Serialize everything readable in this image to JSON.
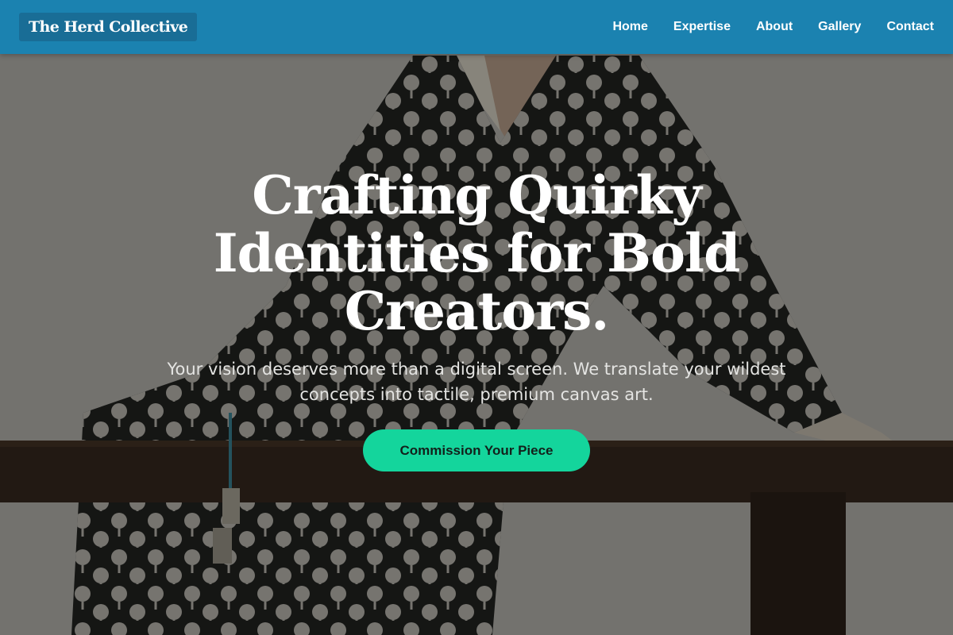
{
  "header": {
    "logo_text": "The Herd Collective",
    "nav": [
      {
        "label": "Home"
      },
      {
        "label": "Expertise"
      },
      {
        "label": "About"
      },
      {
        "label": "Gallery"
      },
      {
        "label": "Contact"
      }
    ]
  },
  "hero": {
    "title": "Crafting Quirky Identities for Bold Creators.",
    "subtitle": "Your vision deserves more than a digital screen. We translate your wildest concepts into tactile, premium canvas art.",
    "cta_label": "Commission Your Piece"
  },
  "colors": {
    "header_bg": "#1b82b0",
    "logo_bg": "#196d96",
    "cta_bg": "#14d59c",
    "cta_text": "#13201b",
    "title_text": "#ffffff"
  }
}
